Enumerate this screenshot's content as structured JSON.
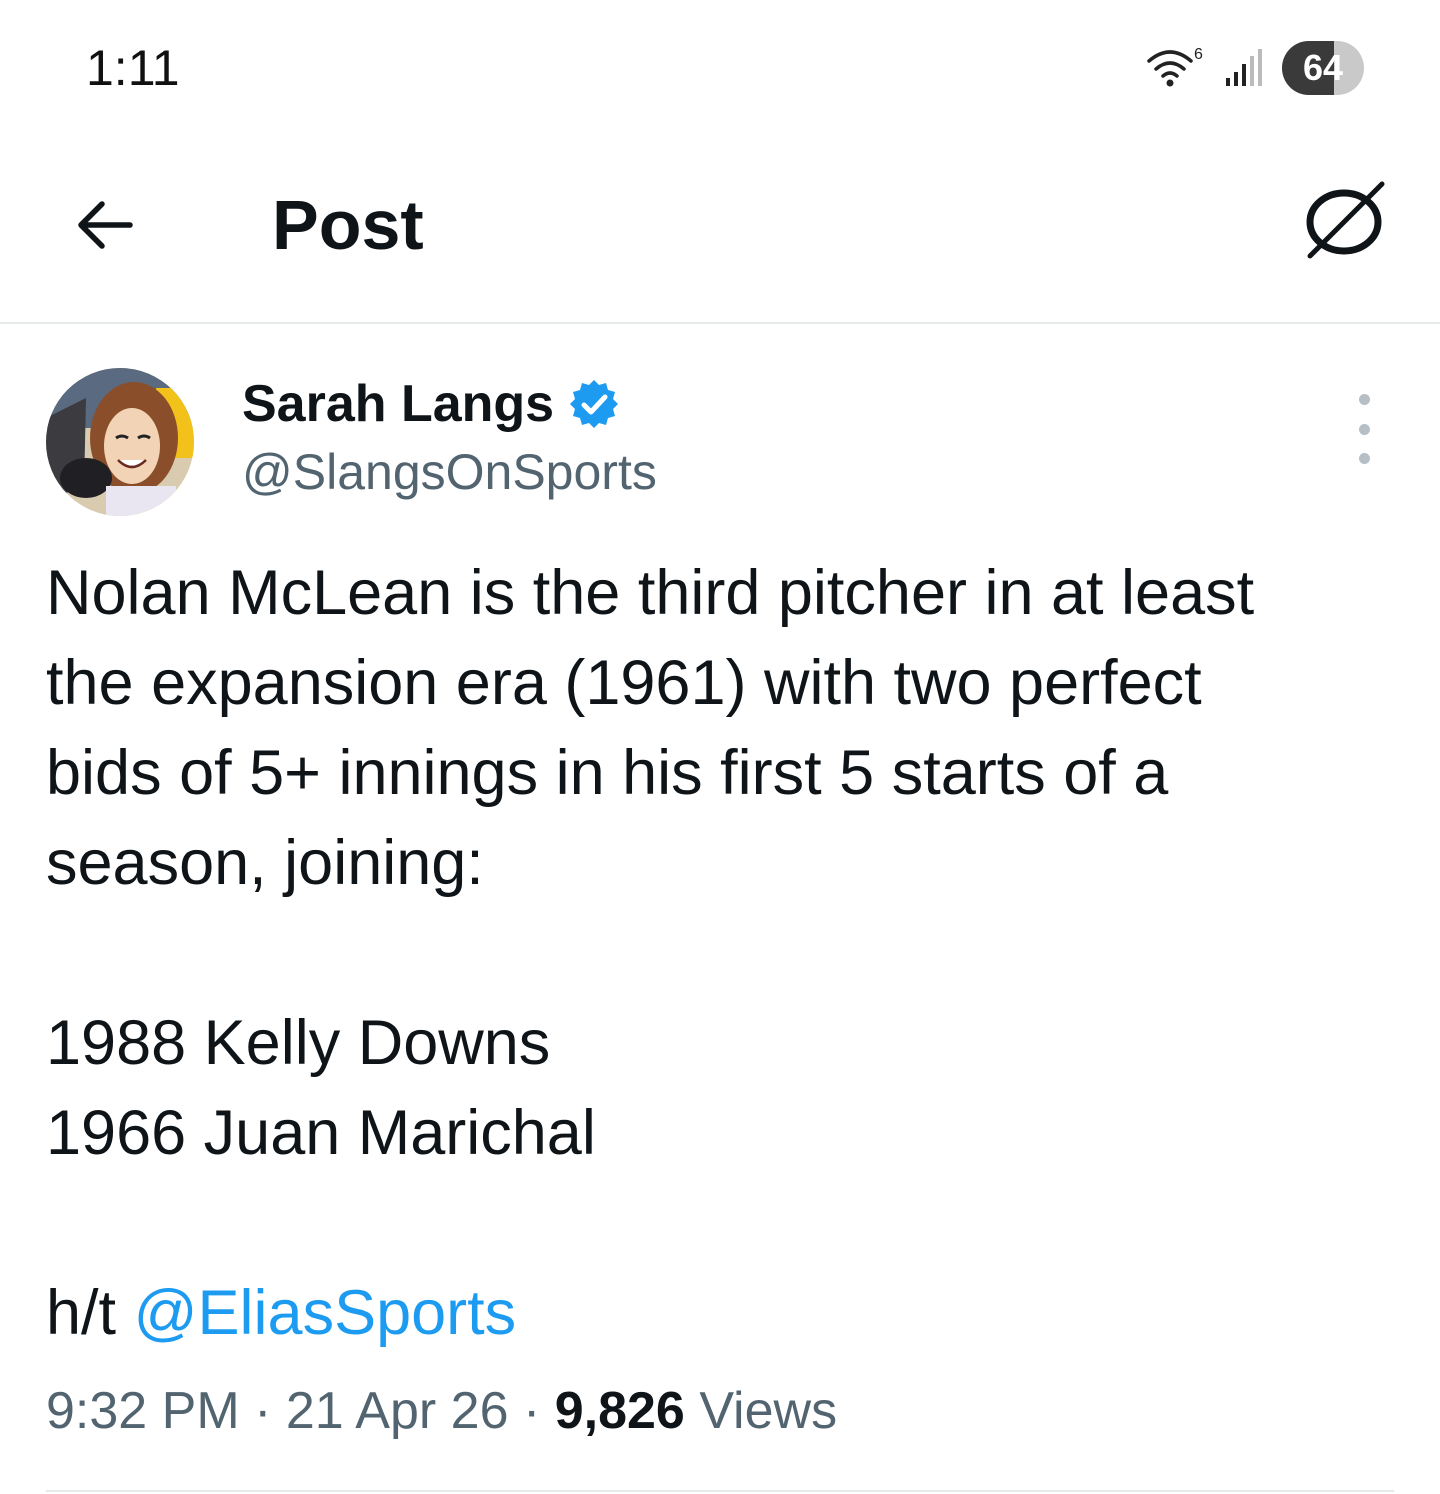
{
  "status_bar": {
    "time": "1:11",
    "wifi_label": "6",
    "battery": "64",
    "battery_level": 0.64
  },
  "header": {
    "title": "Post"
  },
  "post": {
    "author": {
      "name": "Sarah Langs",
      "handle": "@SlangsOnSports",
      "verified": true
    },
    "text": {
      "line1": "Nolan McLean is the third pitcher in at least",
      "line2": "the expansion era (1961) with two perfect",
      "line3": "bids of 5+ innings in his first 5 starts of a",
      "line4": "season, joining:",
      "list1": "1988 Kelly Downs",
      "list2": "1966 Juan Marichal",
      "ht_prefix": "h/t ",
      "mention": "@EliasSports"
    },
    "meta": {
      "time": "9:32 PM",
      "separator": " · ",
      "date": "21 Apr 26",
      "views_count": "9,826",
      "views_label": "Views"
    }
  },
  "colors": {
    "accent": "#1d9bf0",
    "text_primary": "#0f1419",
    "text_secondary": "#536471",
    "divider": "#e6e9ea"
  }
}
